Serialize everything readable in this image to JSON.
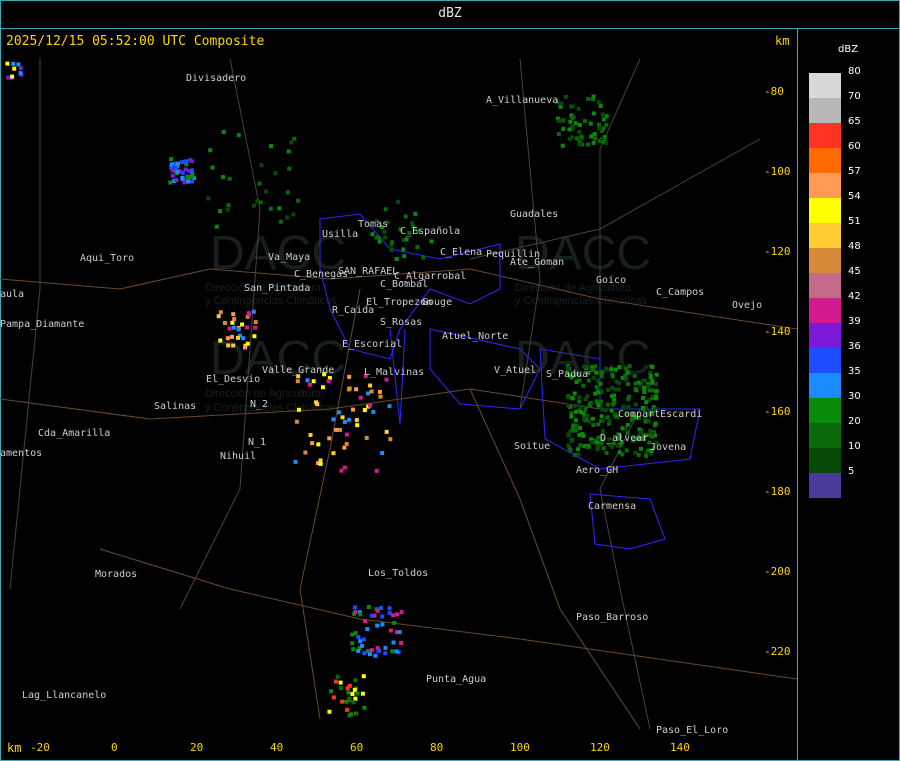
{
  "header": {
    "title": "dBZ"
  },
  "map": {
    "timestamp": "2025/12/15 05:52:00 UTC Composite",
    "unit_top": "km",
    "unit_bottom": "km",
    "x_ticks": [
      "-20",
      "0",
      "20",
      "40",
      "60",
      "80",
      "100",
      "120",
      "140"
    ],
    "y_ticks": [
      "-80",
      "-100",
      "-120",
      "-140",
      "-160",
      "-180",
      "-200",
      "-220"
    ],
    "places": [
      "Divisadero",
      "A_Villanueva",
      "Guadales",
      "Usilla",
      "Tomas",
      "C_Española",
      "C_Elena",
      "Aqui_Toro",
      "Pampa_Diamante",
      "San_Pintada",
      "Va_Maya",
      "C_Benegas",
      "SAN_RAFAEL",
      "C_Algarrobal",
      "C_Bombal",
      "Pequillin",
      "Ate_Goman",
      "Goico",
      "C_Campos",
      "Ovejo",
      "R_Caida",
      "S_Rosas",
      "El_Tropezon",
      "Gouge",
      "E_Escorial",
      "Atuel_Norte",
      "El_Desvio",
      "Valle_Grande",
      "L_Malvinas",
      "V_Atuel",
      "S_Padua",
      "Salinas",
      "N_2",
      "N_1",
      "Nihuil",
      "Cda_Amarilla",
      "amentos",
      "Soitue",
      "Aero_GH",
      "Carmensa",
      "CompartEscardi",
      "Jovena",
      "Los_Toldos",
      "Morados",
      "Paso_Barroso",
      "Punta_Agua",
      "Lag_Llancanelo",
      "Paso_El_Loro",
      "aula",
      "D_alvear"
    ],
    "watermark": {
      "brand": "DACC",
      "line1": "Dirección de Agricultura",
      "line2": "y Contingencias Climáticas"
    }
  },
  "legend": {
    "title": "dBZ",
    "levels": [
      "80",
      "70",
      "65",
      "60",
      "57",
      "54",
      "51",
      "48",
      "45",
      "42",
      "39",
      "36",
      "35",
      "30",
      "20",
      "10",
      "5"
    ],
    "colors": [
      "#d8d8d8",
      "#b8b8b8",
      "#ff3322",
      "#ff6a00",
      "#ff9a55",
      "#ffff00",
      "#ffcc33",
      "#d68a3a",
      "#c26a8a",
      "#d21a8e",
      "#7a1ad6",
      "#1e4cff",
      "#1a8cff",
      "#0a8a0a",
      "#0a6a0a",
      "#064a06",
      "#4a3a9a"
    ]
  }
}
